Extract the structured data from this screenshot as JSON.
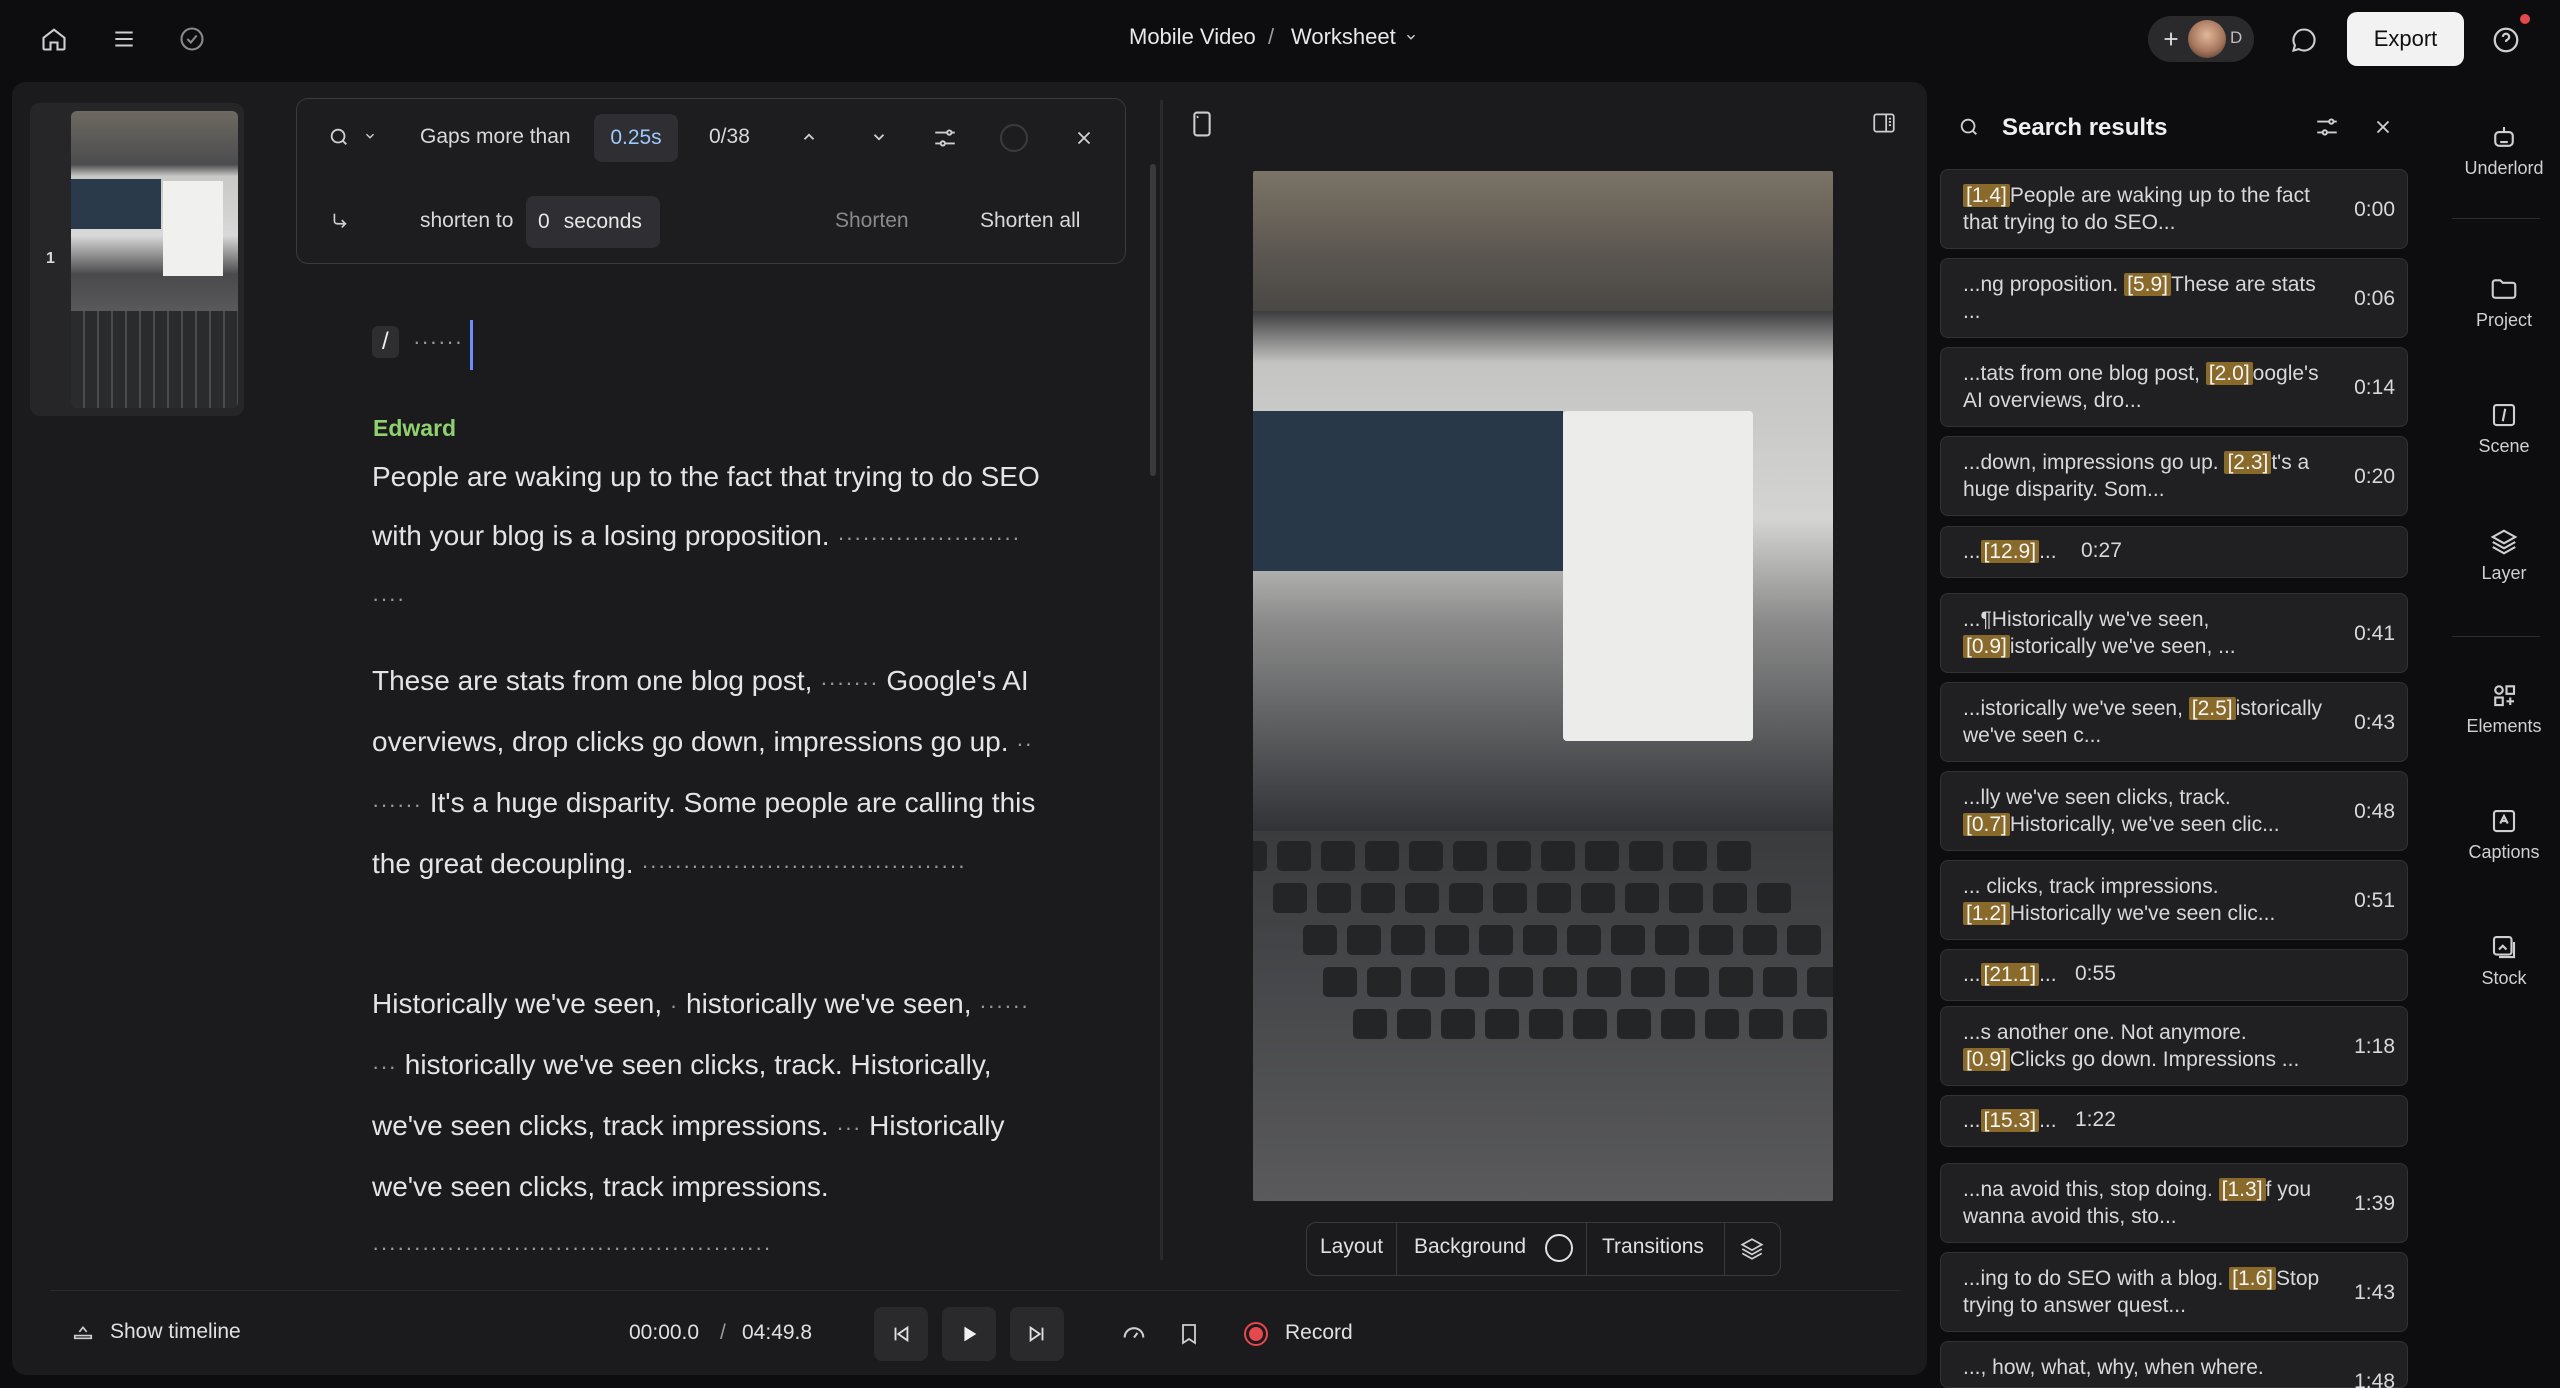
{
  "header": {
    "project": "Mobile Video",
    "separator": "/",
    "doc": "Worksheet",
    "avatar_initial": "D",
    "export_label": "Export"
  },
  "scenes": [
    {
      "number": "1"
    }
  ],
  "gap_tool": {
    "label_gaps": "Gaps more than",
    "gap_value": "0.25s",
    "counter": "0/38",
    "label_shorten_to": "shorten to",
    "shorten_value": "0",
    "label_seconds": "seconds",
    "shorten_label": "Shorten",
    "shorten_all_label": "Shorten all"
  },
  "transcript": {
    "slash": "/",
    "speaker": "Edward",
    "paragraphs": [
      {
        "text": "People are waking up to the fact that trying to do SEO with your blog is a losing proposition.",
        "gap": "······················"
      },
      {
        "text1": "These are stats from one blog post,",
        "gap1": "·······",
        "text2": "Google's AI overviews, drop clicks go down, impressions go up.",
        "gap2": "·· ······",
        "text3": "It's a huge disparity. Some people are calling this the great decoupling.",
        "gap3": "·······································"
      },
      {
        "text1": "Historically we've seen,",
        "gap1": "·",
        "text2": "historically we've seen,",
        "gap2": "······ ···",
        "text3": "historically we've seen clicks, track. Historically, we've seen clicks, track impressions.",
        "gap3": "···",
        "text4": "Historically we've seen clicks, track impressions.",
        "gap4": "················································"
      }
    ]
  },
  "video_toolbar": {
    "layout": "Layout",
    "background": "Background",
    "transitions": "Transitions"
  },
  "footer": {
    "show_timeline": "Show timeline",
    "current_time": "00:00.0",
    "time_sep": "/",
    "total_time": "04:49.8",
    "record": "Record"
  },
  "search_results": {
    "title": "Search results",
    "items": [
      {
        "pre": "",
        "tag": "[1.4]",
        "post": "People are waking up to the fact that trying to do SEO...",
        "time": "0:00"
      },
      {
        "pre": "...ng proposition. ",
        "tag": "[5.9]",
        "post": "These are stats ...",
        "time": "0:06"
      },
      {
        "pre": "...tats from one blog post, ",
        "tag": "[2.0]",
        "post": "oogle's AI overviews, dro...",
        "time": "0:14"
      },
      {
        "pre": "...down, impressions go up. ",
        "tag": "[2.3]",
        "post": "t's a huge disparity. Som...",
        "time": "0:20"
      },
      {
        "pre": "...",
        "tag": "[12.9]",
        "post": "...",
        "time": "0:27"
      },
      {
        "pre": "...¶Historically we've seen, ",
        "tag": "[0.9]",
        "post": "istorically we've seen, ...",
        "time": "0:41"
      },
      {
        "pre": "...istorically we've seen, ",
        "tag": "[2.5]",
        "post": "istorically we've seen c...",
        "time": "0:43"
      },
      {
        "pre": "...lly we've seen clicks, track. ",
        "tag": "[0.7]",
        "post": "Historically, we've seen clic...",
        "time": "0:48"
      },
      {
        "pre": "... clicks, track impressions. ",
        "tag": "[1.2]",
        "post": "Historically we've seen clic...",
        "time": "0:51"
      },
      {
        "pre": "...",
        "tag": "[21.1]",
        "post": "...",
        "time": "0:55"
      },
      {
        "pre": "...s another one. Not anymore. ",
        "tag": "[0.9]",
        "post": "Clicks go down. Impressions ...",
        "time": "1:18"
      },
      {
        "pre": "...",
        "tag": "[15.3]",
        "post": "...",
        "time": "1:22"
      },
      {
        "pre": "...na avoid this, stop doing. ",
        "tag": "[1.3]",
        "post": "f you wanna avoid this, sto...",
        "time": "1:39"
      },
      {
        "pre": "...ing to do SEO with a blog. ",
        "tag": "[1.6]",
        "post": "Stop trying to answer quest...",
        "time": "1:43"
      },
      {
        "pre": "..., how, what, why, when where.",
        "tag": "",
        "post": "",
        "time": "1:48"
      }
    ]
  },
  "rail": {
    "underlord": "Underlord",
    "project": "Project",
    "scene": "Scene",
    "layer": "Layer",
    "elements": "Elements",
    "captions": "Captions",
    "stock": "Stock"
  },
  "colors": {
    "accent_speaker": "#8fd16f",
    "highlight": "#8a6a2a",
    "record": "#e5484d"
  }
}
